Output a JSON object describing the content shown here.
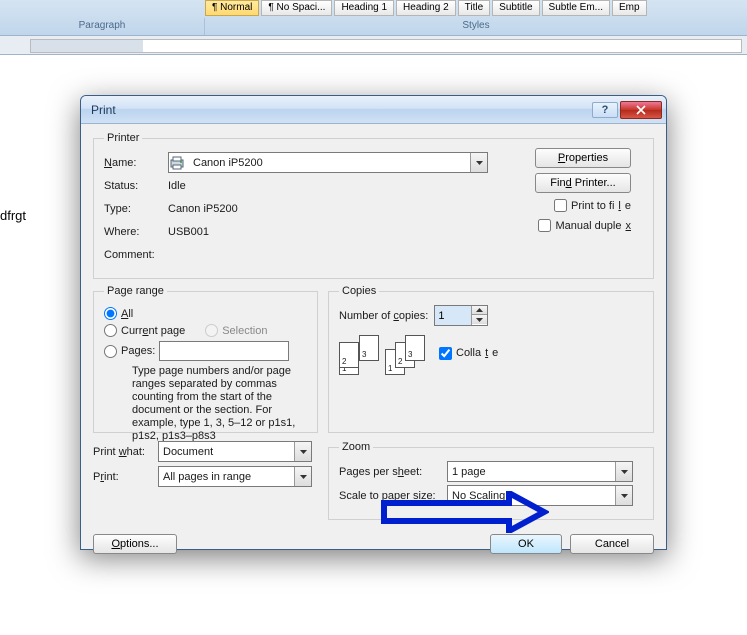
{
  "ribbon": {
    "styles": [
      "¶ Normal",
      "¶ No Spaci...",
      "Heading 1",
      "Heading 2",
      "Title",
      "Subtitle",
      "Subtle Em...",
      "Emp"
    ],
    "group_left": "Paragraph",
    "group_right": "Styles"
  },
  "document": {
    "text": "dfrgt"
  },
  "dialog": {
    "title": "Print",
    "printer": {
      "legend": "Printer",
      "name_label": "Name:",
      "name_value": "Canon iP5200",
      "status_label": "Status:",
      "status_value": "Idle",
      "type_label": "Type:",
      "type_value": "Canon iP5200",
      "where_label": "Where:",
      "where_value": "USB001",
      "comment_label": "Comment:",
      "comment_value": "",
      "properties_btn": "Properties",
      "find_printer_btn": "Find Printer...",
      "print_to_file": "Print to file",
      "manual_duplex": "Manual duplex"
    },
    "page_range": {
      "legend": "Page range",
      "all": "All",
      "current": "Current page",
      "selection": "Selection",
      "pages": "Pages:",
      "hint": "Type page numbers and/or page ranges separated by commas counting from the start of the document or the section. For example, type 1, 3, 5–12 or p1s1, p1s2, p1s3–p8s3"
    },
    "copies": {
      "legend": "Copies",
      "number_label": "Number of copies:",
      "number_value": "1",
      "collate": "Collate"
    },
    "print_what": {
      "label": "Print what:",
      "value": "Document"
    },
    "print": {
      "label": "Print:",
      "value": "All pages in range"
    },
    "zoom": {
      "legend": "Zoom",
      "pps_label": "Pages per sheet:",
      "pps_value": "1 page",
      "scale_label": "Scale to paper size:",
      "scale_value": "No Scaling"
    },
    "options_btn": "Options...",
    "ok_btn": "OK",
    "cancel_btn": "Cancel"
  }
}
